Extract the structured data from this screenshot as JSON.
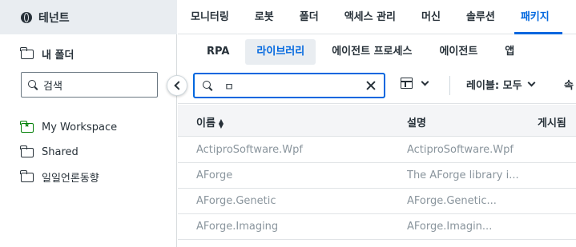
{
  "sidebar": {
    "tenant_label": "테넌트",
    "my_folder_label": "내 폴더",
    "search_placeholder": "검색",
    "folders": [
      {
        "label": "My Workspace",
        "icon": "workspace-folder-icon"
      },
      {
        "label": "Shared",
        "icon": "folder-icon"
      },
      {
        "label": "일일언론동향",
        "icon": "folder-icon"
      }
    ]
  },
  "topnav": {
    "tabs": [
      "모니터링",
      "로봇",
      "폴더",
      "액세스 관리",
      "머신",
      "솔루션",
      "패키지"
    ],
    "active": "패키지"
  },
  "subnav": {
    "tabs": [
      "RPA",
      "라이브러리",
      "에이전트 프로세스",
      "에이전트",
      "앱"
    ],
    "active": "라이브러리"
  },
  "toolbar": {
    "search_value": "ㅁ",
    "label_filter": "레이블: 모두",
    "extra_filter": "속"
  },
  "table": {
    "headers": {
      "name": "이름",
      "description": "설명",
      "published": "게시됨"
    },
    "rows": [
      {
        "name": "ActiproSoftware.Wpf",
        "description": "ActiproSoftware.Wpf"
      },
      {
        "name": "AForge",
        "description": "The AForge library i..."
      },
      {
        "name": "AForge.Genetic",
        "description": "AForge.Genetic..."
      },
      {
        "name": "AForge.Imaging",
        "description": "AForge.Imagin..."
      }
    ]
  },
  "colors": {
    "accent": "#0067df",
    "text": "#273139",
    "muted": "#8a959d",
    "header_bg": "#f4f5f7",
    "tenant_bg": "#e9edf1"
  }
}
